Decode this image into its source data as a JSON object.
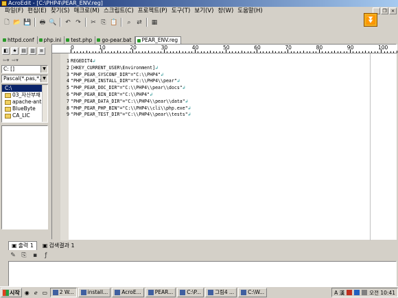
{
  "window": {
    "title": "AcroEdit - [C:\\PHP4\\PEAR_ENV.reg]"
  },
  "menu": [
    "파일(F)",
    "편집(E)",
    "찾기(S)",
    "매크로(M)",
    "스크립트(C)",
    "프로젝트(P)",
    "도구(T)",
    "보기(V)",
    "창(W)",
    "도움말(H)"
  ],
  "tabs": [
    {
      "label": "httpd.conf",
      "active": false
    },
    {
      "label": "php.ini",
      "active": false
    },
    {
      "label": "test.php",
      "active": false
    },
    {
      "label": "go-pear.bat",
      "active": false
    },
    {
      "label": "PEAR_ENV.reg",
      "active": true
    }
  ],
  "left_panel": {
    "drive": "C: []",
    "filter": "Pascal(*.pas,*.d",
    "folders": [
      {
        "name": "C:\\",
        "selected": true
      },
      {
        "name": "03_자산부채",
        "selected": false
      },
      {
        "name": "apache-ant-",
        "selected": false
      },
      {
        "name": "BlueByte",
        "selected": false
      },
      {
        "name": "CA_LIC",
        "selected": false
      }
    ]
  },
  "ruler": [
    "0",
    "10",
    "20",
    "30",
    "40",
    "50",
    "60",
    "70",
    "80",
    "90",
    "100"
  ],
  "editor": {
    "lines": [
      {
        "n": "1",
        "text": "REGEDIT4"
      },
      {
        "n": "2",
        "text": "[HKEY_CURRENT_USER\\Environment]"
      },
      {
        "n": "3",
        "text": "\"PHP_PEAR_SYSCONF_DIR\"=\"C:\\\\PHP4\""
      },
      {
        "n": "4",
        "text": "\"PHP_PEAR_INSTALL_DIR\"=\"C:\\\\PHP4\\\\pear\""
      },
      {
        "n": "5",
        "text": "\"PHP_PEAR_DOC_DIR\"=\"C:\\\\PHP4\\\\pear\\\\docs\""
      },
      {
        "n": "6",
        "text": "\"PHP_PEAR_BIN_DIR\"=\"C:\\\\PHP4\""
      },
      {
        "n": "7",
        "text": "\"PHP_PEAR_DATA_DIR\"=\"C:\\\\PHP4\\\\pear\\\\data\""
      },
      {
        "n": "8",
        "text": "\"PHP_PEAR_PHP_BIN\"=\"C:\\\\PHP4\\\\cli\\\\php.exe\""
      },
      {
        "n": "9",
        "text": "\"PHP_PEAR_TEST_DIR\"=\"C:\\\\PHP4\\\\pear\\\\tests\""
      }
    ],
    "eol_mark": "↲"
  },
  "output_tabs": [
    {
      "label": "출력 1",
      "active": true
    },
    {
      "label": "검색결과 1",
      "active": false
    }
  ],
  "taskbar": {
    "start": "시작",
    "items": [
      "2 W...",
      "install...",
      "AcroE...",
      "PEAR...",
      "C:\\P...",
      "그림4 ...",
      "C:\\W..."
    ],
    "time": "오전 10:41",
    "ime": "A 漢"
  }
}
